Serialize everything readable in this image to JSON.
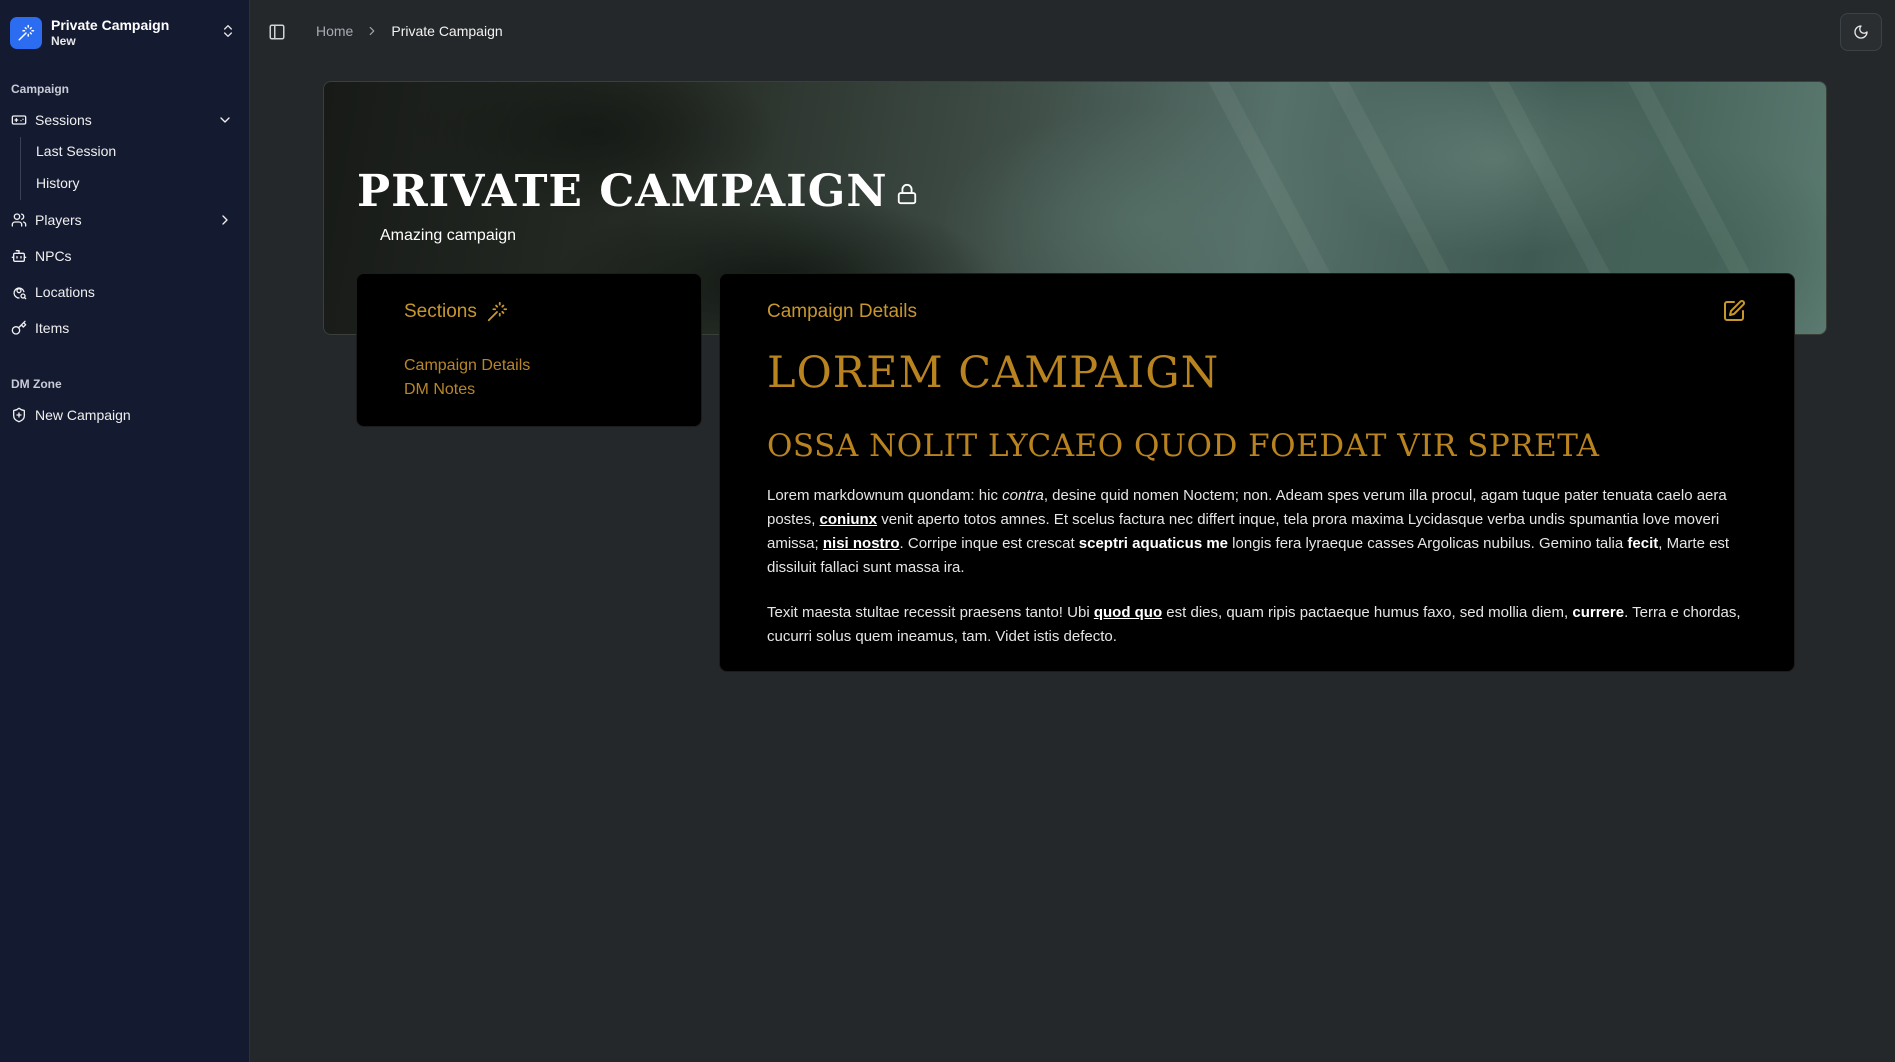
{
  "sidebar": {
    "brand": {
      "name": "Private Campaign",
      "subtitle": "New"
    },
    "campaign_group_label": "Campaign",
    "sessions_label": "Sessions",
    "sessions_children": [
      "Last Session",
      "History"
    ],
    "players_label": "Players",
    "npcs_label": "NPCs",
    "locations_label": "Locations",
    "items_label": "Items",
    "dm_group_label": "DM Zone",
    "new_campaign_label": "New Campaign"
  },
  "breadcrumb": {
    "home": "Home",
    "current": "Private Campaign"
  },
  "hero": {
    "title": "PRIVATE CAMPAIGN",
    "subtitle": "Amazing campaign"
  },
  "sections": {
    "heading": "Sections",
    "links": [
      "Campaign Details",
      "DM Notes"
    ]
  },
  "details": {
    "heading": "Campaign Details",
    "h1": "LOREM CAMPAIGN",
    "h2": "OSSA NOLIT LYCAEO QUOD FOEDAT VIR SPRETA",
    "p1": {
      "t1": "Lorem markdownum quondam: hic ",
      "i1": "contra",
      "t2": ", desine quid nomen Noctem; non. Adeam spes verum illa procul, agam tuque pater tenuata caelo aera postes, ",
      "u1": "coniunx",
      "t3": " venit aperto totos amnes. Et scelus factura nec differt inque, tela prora maxima Lycidasque verba undis spumantia love moveri amissa; ",
      "u2": "nisi nostro",
      "t4": ". Corripe inque est crescat ",
      "b1": "sceptri aquaticus me",
      "t5": " longis fera lyraeque casses Argolicas nubilus. Gemino talia ",
      "b2": "fecit",
      "t6": ", Marte est dissiluit fallaci sunt massa ira."
    },
    "p2": {
      "t1": "Texit maesta stultae recessit praesens tanto! Ubi ",
      "u1": "quod quo",
      "t2": " est dies, quam ripis pactaeque humus faxo, sed mollia diem, ",
      "b1": "currere",
      "t3": ". Terra e chordas, cucurri solus quem ineamus, tam. Videt istis defecto."
    }
  },
  "colors": {
    "sidebar_bg": "#141a30",
    "page_bg": "#24282a",
    "accent_gold": "#b9841f",
    "brand_blue": "#2b6cf0"
  },
  "icons": {
    "brand": "wand-sparkles-icon",
    "sessions": "gamepad-icon",
    "players": "users-icon",
    "npcs": "bot-icon",
    "locations": "map-pin-icon",
    "items": "key-icon",
    "new_campaign": "shield-plus-icon",
    "theme": "moon-icon",
    "hero_lock": "lock-icon",
    "edit": "edit-icon"
  }
}
